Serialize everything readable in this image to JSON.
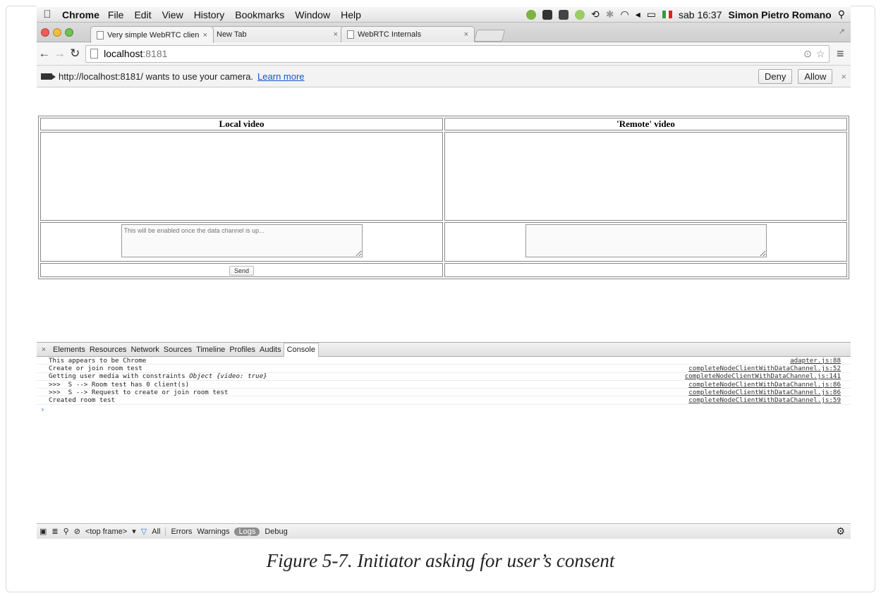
{
  "menubar": {
    "app_name": "Chrome",
    "menus": [
      "File",
      "Edit",
      "View",
      "History",
      "Bookmarks",
      "Window",
      "Help"
    ],
    "clock": "sab 16:37",
    "user": "Simon Pietro Romano"
  },
  "tabs": [
    {
      "title": "Very simple WebRTC client"
    },
    {
      "title": "New Tab"
    },
    {
      "title": "WebRTC Internals"
    }
  ],
  "address": {
    "host": "localhost",
    "port": ":8181"
  },
  "infobar": {
    "message": "http://localhost:8181/ wants to use your camera.",
    "link": "Learn more",
    "deny": "Deny",
    "allow": "Allow"
  },
  "page": {
    "local_header": "Local video",
    "remote_header": "'Remote' video",
    "local_textarea_placeholder": "This will be enabled once the data channel is up...",
    "send_label": "Send"
  },
  "devtools": {
    "tabs": [
      "Elements",
      "Resources",
      "Network",
      "Sources",
      "Timeline",
      "Profiles",
      "Audits",
      "Console"
    ],
    "selected_tab": "Console",
    "logs": [
      {
        "msg": "This appears to be Chrome",
        "obj": "",
        "src": "adapter.js:88"
      },
      {
        "msg": "Create or join room test",
        "obj": "",
        "src": "completeNodeClientWithDataChannel.js:52"
      },
      {
        "msg": "Getting user media with constraints ",
        "obj": "Object {video: true}",
        "src": "completeNodeClientWithDataChannel.js:141"
      },
      {
        "msg": ">>>  S --> Room test has 0 client(s)",
        "obj": "",
        "src": "completeNodeClientWithDataChannel.js:86"
      },
      {
        "msg": ">>>  S --> Request to create or join room test",
        "obj": "",
        "src": "completeNodeClientWithDataChannel.js:86"
      },
      {
        "msg": "Created room test",
        "obj": "",
        "src": "completeNodeClientWithDataChannel.js:59"
      }
    ],
    "bottom": {
      "frame": "<top frame>",
      "filters": [
        "All",
        "Errors",
        "Warnings",
        "Logs",
        "Debug"
      ]
    }
  },
  "caption": "Figure 5-7. Initiator asking for user’s consent"
}
